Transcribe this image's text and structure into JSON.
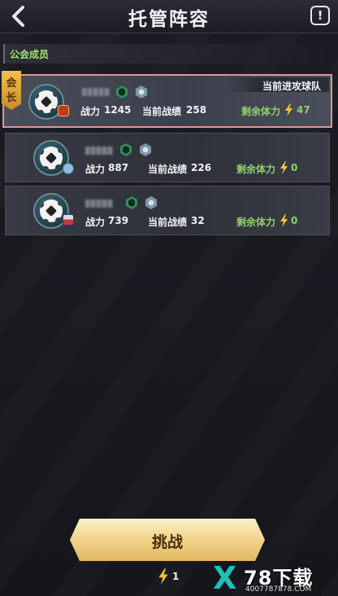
{
  "header": {
    "title": "托管阵容",
    "back_icon": "back-arrow-icon",
    "info_icon": "info-icon",
    "info_glyph": "!"
  },
  "section": {
    "label": "公会成员"
  },
  "leader_tag": {
    "chars": [
      "会",
      "长"
    ]
  },
  "members": [
    {
      "power_label": "战力",
      "power": "1245",
      "record_label": "当前战绩",
      "record": "258",
      "stamina_label": "剩余体力",
      "stamina": "47",
      "status": "当前进攻球队",
      "selected": true
    },
    {
      "power_label": "战力",
      "power": "887",
      "record_label": "当前战绩",
      "record": "226",
      "stamina_label": "剩余体力",
      "stamina": "0",
      "selected": false
    },
    {
      "power_label": "战力",
      "power": "739",
      "record_label": "当前战绩",
      "record": "32",
      "stamina_label": "剩余体力",
      "stamina": "0",
      "selected": false
    }
  ],
  "challenge": {
    "label": "挑战",
    "cost": "1"
  },
  "watermark": {
    "brand": "78下载",
    "url": "4007787878.COM"
  },
  "colors": {
    "accent_green": "#8fd06a",
    "gold": "#f2d58e",
    "selected_border": "#d79a92"
  }
}
